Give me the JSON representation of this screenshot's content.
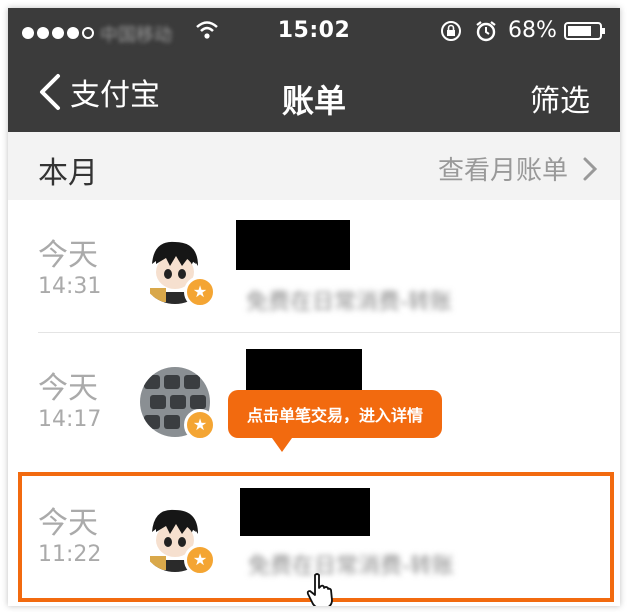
{
  "status_bar": {
    "carrier": "中国移动",
    "time": "15:02",
    "battery": "68%"
  },
  "nav": {
    "back_label": "支付宝",
    "title": "账单",
    "filter_label": "筛选"
  },
  "month": {
    "label": "本月",
    "monthly_bill_link": "查看月账单"
  },
  "transactions": [
    {
      "day": "今天",
      "time": "14:31",
      "detail": "免费在日常消费-转账"
    },
    {
      "day": "今天",
      "time": "14:17",
      "detail": ""
    },
    {
      "day": "今天",
      "time": "11:22",
      "detail": "免费在日常消费-转账"
    }
  ],
  "tooltip": {
    "text": "点击单笔交易，进入详情"
  },
  "colors": {
    "accent": "#f26a0f",
    "bar": "#3b3b3b",
    "badge": "#f4a533"
  },
  "icons": [
    "wifi-icon",
    "rotation-lock-icon",
    "alarm-icon",
    "battery-icon",
    "back-chevron-icon",
    "chevron-right-icon",
    "star-badge-icon",
    "pointer-cursor-icon"
  ]
}
